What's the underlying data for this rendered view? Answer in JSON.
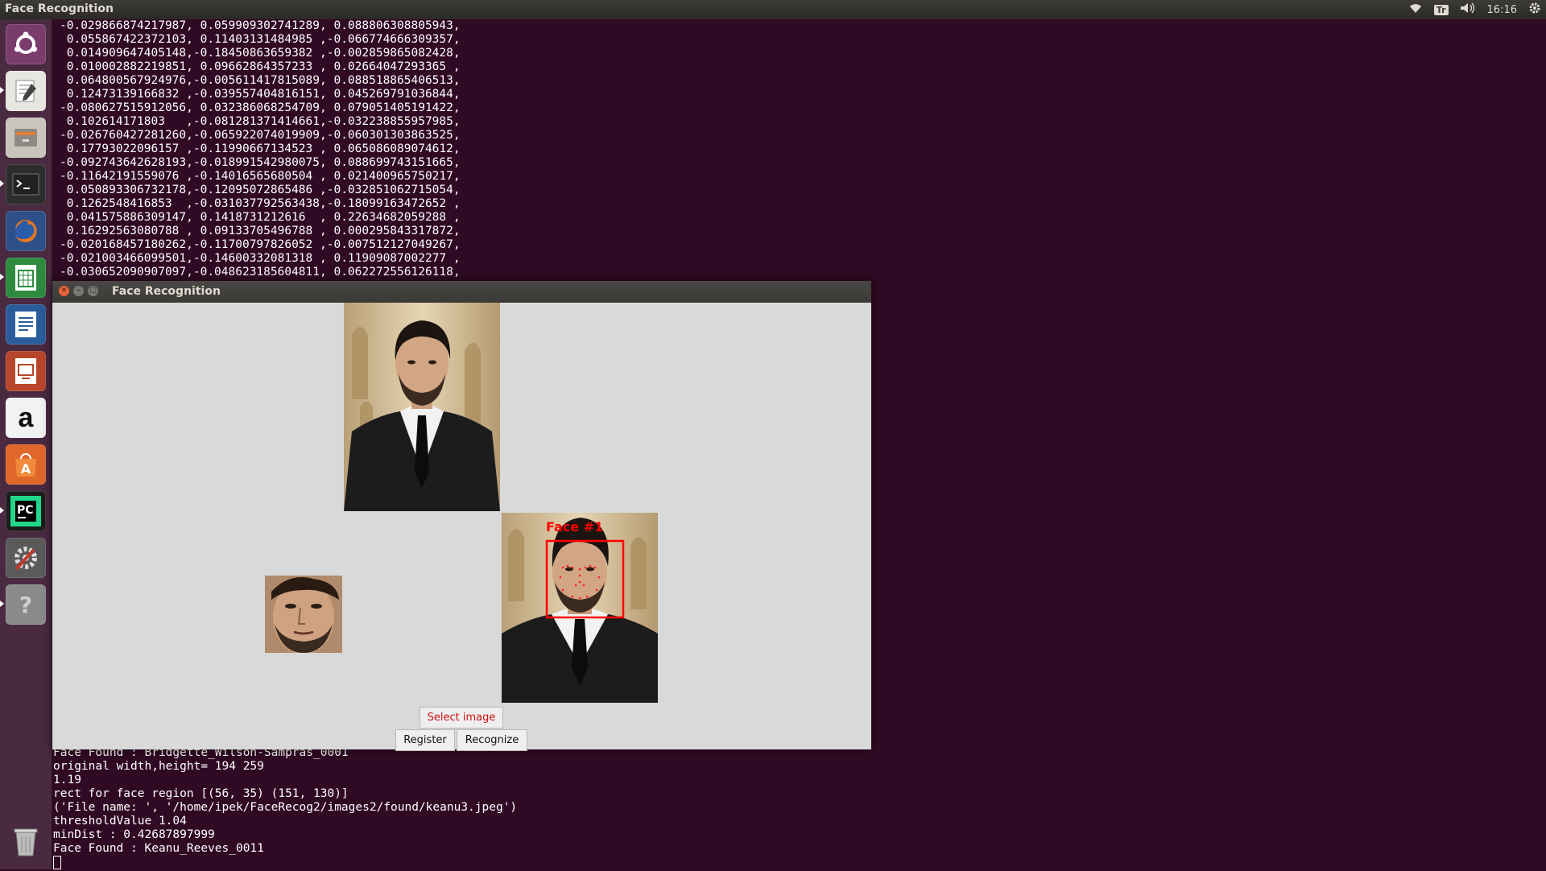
{
  "top_panel": {
    "title": "Face Recognition",
    "keyboard_indicator": "Tr",
    "clock": "16:16"
  },
  "launcher": {
    "icons": [
      "ubuntu-dash-icon",
      "text-editor-icon",
      "files-icon",
      "terminal-icon",
      "firefox-icon",
      "calc-spreadsheet-icon",
      "writer-document-icon",
      "impress-presentation-icon",
      "amazon-icon",
      "software-center-icon",
      "pycharm-icon",
      "system-settings-icon",
      "help-icon",
      "trash-icon"
    ]
  },
  "terminal": {
    "top_lines": [
      "-0.029866874217987, 0.059909302741289, 0.088806308805943,",
      " 0.055867422372103, 0.11403131484985 ,-0.066774666309357,",
      " 0.014909647405148,-0.18450863659382 ,-0.002859865082428,",
      " 0.010002882219851, 0.09662864357233 , 0.02664047293365 ,",
      " 0.064800567924976,-0.005611417815089, 0.08851886540651З,",
      " 0.12473139166832 ,-0.039557404816151, 0.045269791036844,",
      "-0.080627515912056, 0.032386068254709, 0.079051405191422,",
      " 0.102614171803   ,-0.081281371414661,-0.032238855957985,",
      "-0.026760427281260,-0.065922074019909,-0.060301303863525,",
      " 0.17793022096157 ,-0.11990667134523 , 0.065086089074612,",
      "-0.092743642628193,-0.018991542980075, 0.088699743151665,",
      "-0.11642191559076 ,-0.14016565680504 , 0.021400965750217,",
      " 0.050893306732178,-0.12095072865486 ,-0.032851062715054,",
      " 0.1262548416853  ,-0.031037792563438,-0.18099163472652 ,",
      " 0.041575886309147, 0.1418731212616  , 0.22634682059288 ,",
      " 0.16292563080788 , 0.09133705496788 , 0.000295843317872,",
      "-0.020168457180262,-0.11700797826052 ,-0.007512127049267,",
      "-0.021003466099501,-0.14600332081318 , 0.11909087002277 ,",
      "-0.030652090907097,-0.048623185604811, 0.062272556126118,"
    ],
    "bottom_lines": [
      "Face Found : Bridgette_Wilson-Sampras_0001",
      "original width,height= 194 259",
      "1.19",
      "rect for face region [(56, 35) (151, 130)]",
      "('File name: ', '/home/ipek/FaceRecog2/images2/found/keanu3.jpeg')",
      "thresholdValue 1.04",
      "minDist : 0.42687897999",
      "Face Found : Keanu_Reeves_0011"
    ]
  },
  "window": {
    "title": "Face Recognition",
    "face_label": "Face #1",
    "buttons": {
      "select_image": "Select image",
      "register": "Register",
      "recognize": "Recognize"
    }
  },
  "colors": {
    "desktop": "#300a24",
    "detection_box": "#ff0000",
    "select_text": "#cc1111"
  }
}
